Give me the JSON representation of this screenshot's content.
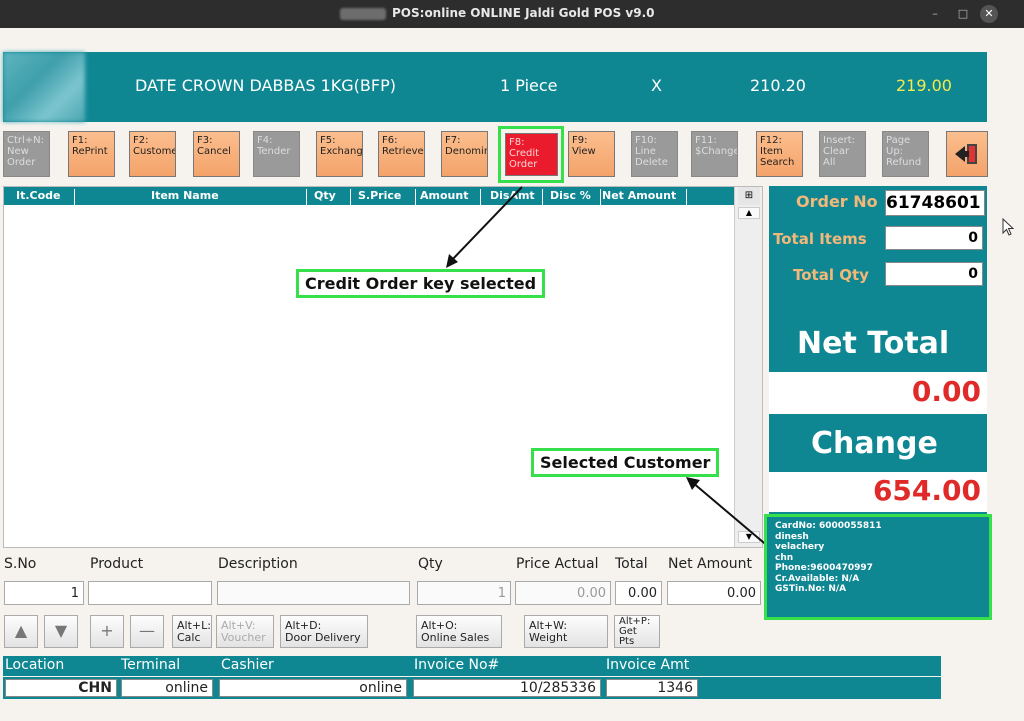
{
  "window": {
    "title": "POS:online   ONLINE Jaldi Gold POS v9.0",
    "minimize": "–",
    "maximize": "□",
    "close": "✕"
  },
  "item_bar": {
    "name": "DATE CROWN DABBAS 1KG(BFP)",
    "qty": "1 Piece",
    "times": "X",
    "price": "210.20",
    "total": "219.00"
  },
  "fkeys": [
    {
      "label": "Ctrl+N:\nNew\nOrder",
      "state": "disabled"
    },
    {
      "label": "F1:\nRePrint",
      "state": "enabled"
    },
    {
      "label": "F2:\nCustome",
      "state": "enabled"
    },
    {
      "label": "F3:\nCancel",
      "state": "enabled"
    },
    {
      "label": "F4:\nTender",
      "state": "disabled"
    },
    {
      "label": "F5:\nExchang",
      "state": "enabled"
    },
    {
      "label": "F6:\nRetrieve",
      "state": "enabled"
    },
    {
      "label": "F7:\nDenomin",
      "state": "enabled"
    },
    {
      "label": "F8:\nCredit\nOrder",
      "state": "selected"
    },
    {
      "label": "F9:\nView",
      "state": "enabled"
    },
    {
      "label": "F10:\nLine\nDelete",
      "state": "disabled"
    },
    {
      "label": "F11:\n$Change",
      "state": "disabled"
    },
    {
      "label": "F12:\nItem\nSearch",
      "state": "enabled"
    },
    {
      "label": "Insert:\nClear All",
      "state": "disabled"
    },
    {
      "label": "Page\nUp:\nRefund",
      "state": "disabled"
    }
  ],
  "grid": {
    "columns": [
      "It.Code",
      "Item Name",
      "Qty",
      "S.Price",
      "Amount",
      "DisAmt",
      "Disc %",
      "Net Amount"
    ]
  },
  "annotations": {
    "credit_note": "Credit Order key selected",
    "customer_note": "Selected Customer"
  },
  "order_panel": {
    "order_no_label": "Order No",
    "order_no": "61748601",
    "total_items_label": "Total Items",
    "total_items": "0",
    "total_qty_label": "Total Qty",
    "total_qty": "0",
    "net_total_label": "Net Total",
    "net_total": "0.00",
    "change_label": "Change",
    "change": "654.00"
  },
  "customer": {
    "card": "CardNo: 6000055811",
    "name": "dinesh",
    "area": "velachery",
    "city": "chn",
    "phone": "Phone:9600470997",
    "credit": "Cr.Available: N/A",
    "gstin": "GSTin.No: N/A"
  },
  "entry": {
    "sno_label": "S.No",
    "product_label": "Product",
    "description_label": "Description",
    "qty_label": "Qty",
    "price_label": "Price Actual",
    "total_label": "Total",
    "net_label": "Net Amount",
    "sno": "1",
    "product": "",
    "description": "",
    "qty": "1",
    "price": "0.00",
    "total": "0.00",
    "net": "0.00"
  },
  "shortcuts": {
    "up": "▲",
    "down": "▼",
    "plus": "+",
    "minus": "—",
    "calc": "Alt+L:\nCalc",
    "voucher": "Alt+V:\nVoucher",
    "door": "Alt+D:\nDoor Delivery",
    "online": "Alt+O:\nOnline Sales",
    "weight": "Alt+W:\nWeight",
    "points": "Alt+P:\nGet\nPts"
  },
  "footer": {
    "location_label": "Location",
    "terminal_label": "Terminal",
    "cashier_label": "Cashier",
    "invoice_label": "Invoice No#",
    "amount_label": "Invoice Amt",
    "location": "CHN",
    "terminal": "online",
    "cashier": "online",
    "invoice": "10/285336",
    "amount": "1346"
  }
}
